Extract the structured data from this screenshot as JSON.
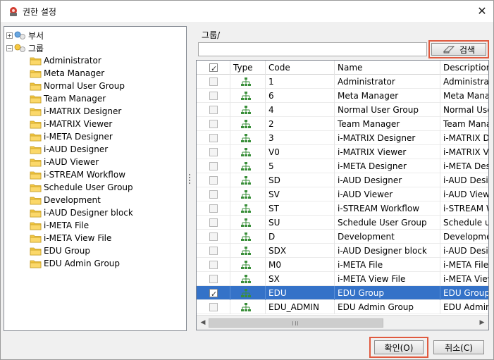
{
  "window": {
    "title": "권한 설정"
  },
  "tree": {
    "nodes": [
      {
        "label": "부서",
        "expander": "+"
      },
      {
        "label": "그룹",
        "expander": "−"
      }
    ],
    "groups": [
      "Administrator",
      "Meta Manager",
      "Normal User Group",
      "Team Manager",
      "i-MATRIX Designer",
      "i-MATRIX Viewer",
      "i-META Designer",
      "i-AUD Designer",
      "i-AUD Viewer",
      "i-STREAM Workflow",
      "Schedule User Group",
      "Development",
      "i-AUD Designer block",
      "i-META File",
      "i-META View File",
      "EDU Group",
      "EDU Admin Group"
    ]
  },
  "search": {
    "path_label": "그룹/",
    "value": "",
    "button_label": "검색"
  },
  "grid": {
    "columns": [
      "Type",
      "Code",
      "Name",
      "Description"
    ],
    "rows": [
      {
        "code": "1",
        "name": "Administrator",
        "description": "Administrator",
        "checked": false
      },
      {
        "code": "6",
        "name": "Meta Manager",
        "description": "Meta Manager",
        "checked": false
      },
      {
        "code": "4",
        "name": "Normal User Group",
        "description": "Normal User Group",
        "checked": false
      },
      {
        "code": "2",
        "name": "Team Manager",
        "description": "Team Manager",
        "checked": false
      },
      {
        "code": "3",
        "name": "i-MATRIX Designer",
        "description": "i-MATRIX Designer",
        "checked": false
      },
      {
        "code": "V0",
        "name": "i-MATRIX Viewer",
        "description": "i-MATRIX Viewer",
        "checked": false
      },
      {
        "code": "5",
        "name": "i-META Designer",
        "description": "i-META Designer",
        "checked": false
      },
      {
        "code": "SD",
        "name": "i-AUD Designer",
        "description": "i-AUD Designer",
        "checked": false
      },
      {
        "code": "SV",
        "name": "i-AUD Viewer",
        "description": "i-AUD Viewer",
        "checked": false
      },
      {
        "code": "ST",
        "name": "i-STREAM Workflow",
        "description": "i-STREAM Workflow",
        "checked": false
      },
      {
        "code": "SU",
        "name": "Schedule User Group",
        "description": "Schedule user",
        "checked": false
      },
      {
        "code": "D",
        "name": "Development",
        "description": "Development",
        "checked": false
      },
      {
        "code": "SDX",
        "name": "i-AUD Designer block",
        "description": "i-AUD Designer",
        "checked": false
      },
      {
        "code": "M0",
        "name": "i-META File",
        "description": "i-META File",
        "checked": false
      },
      {
        "code": "SX",
        "name": "i-META View File",
        "description": "i-META View",
        "checked": false
      },
      {
        "code": "EDU",
        "name": "EDU Group",
        "description": "EDU Group",
        "checked": true,
        "selected": true
      },
      {
        "code": "EDU_ADMIN",
        "name": "EDU Admin Group",
        "description": "EDU Admin",
        "checked": false
      }
    ]
  },
  "buttons": {
    "ok_label": "확인(O)",
    "cancel_label": "취소(C)"
  },
  "colors": {
    "selection": "#3472c8",
    "highlight_border": "#e05a3f",
    "folder": "#f5c842"
  },
  "icons": {
    "tree_node": "network-icon",
    "group_folder": "folder-icon",
    "row_type": "org-chart-icon",
    "search": "eraser-icon"
  }
}
